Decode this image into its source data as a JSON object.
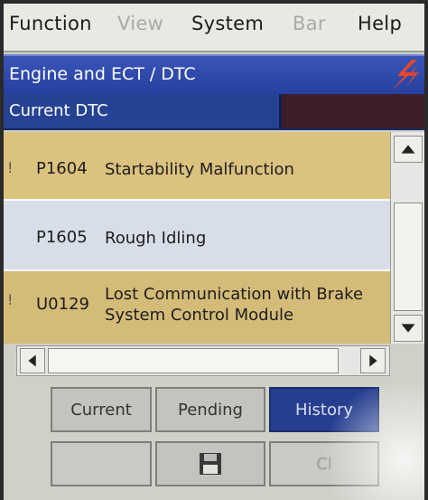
{
  "menu": {
    "items": [
      {
        "label": "Function",
        "enabled": true
      },
      {
        "label": "View",
        "enabled": false
      },
      {
        "label": "System",
        "enabled": true
      },
      {
        "label": "Bar",
        "enabled": false
      },
      {
        "label": "Help",
        "enabled": true
      }
    ]
  },
  "titlebar": {
    "title": "Engine and ECT / DTC",
    "icon": "lightning-bolt-icon"
  },
  "subheader": {
    "label": "Current DTC"
  },
  "dtc_list": [
    {
      "flag": "!",
      "code": "P1604",
      "description": "Startability Malfunction"
    },
    {
      "flag": "",
      "code": "P1605",
      "description": "Rough Idling"
    },
    {
      "flag": "!",
      "code": "U0129",
      "description": "Lost Communication with Brake System Control Module"
    }
  ],
  "buttons": {
    "current": "Current",
    "pending": "Pending",
    "history": "History",
    "save_icon": "floppy-disk-icon",
    "clear": "Cl"
  },
  "colors": {
    "title_bar": "#2540a0",
    "active_button": "#263e8f",
    "row_highlight": "#dcc27f",
    "row_normal": "#d7dee8"
  }
}
